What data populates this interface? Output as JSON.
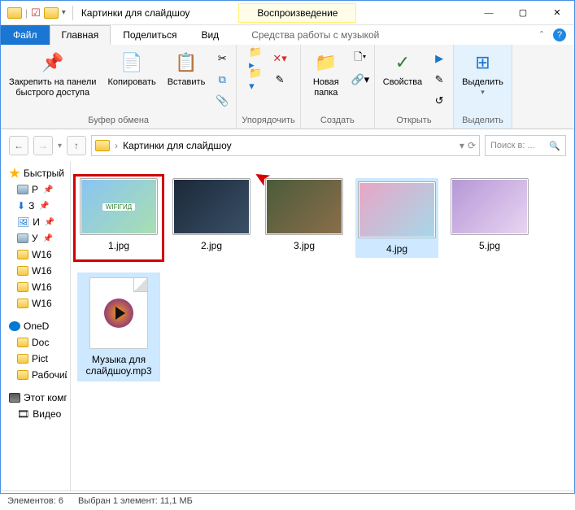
{
  "title": "Картинки для слайдшоу",
  "contextual_tab": "Воспроизведение",
  "tabs": {
    "file": "Файл",
    "home": "Главная",
    "share": "Поделиться",
    "view": "Вид",
    "music": "Средства работы с музыкой"
  },
  "ribbon": {
    "clipboard": {
      "label": "Буфер обмена",
      "pin": "Закрепить на панели\nбыстрого доступа",
      "copy": "Копировать",
      "paste": "Вставить"
    },
    "organize": {
      "label": "Упорядочить"
    },
    "new": {
      "label": "Создать",
      "folder": "Новая\nпапка"
    },
    "open": {
      "label": "Открыть",
      "props": "Свойства"
    },
    "select": {
      "label": "Выделить",
      "all": "Выделить"
    }
  },
  "nav": {
    "breadcrumb": [
      "Картинки для слайдшоу"
    ],
    "search_placeholder": "Поиск в: ..."
  },
  "tree": {
    "quick": "Быстрый доступ",
    "items": [
      "Р",
      "З",
      "И",
      "У"
    ],
    "wifi": [
      "W16",
      "W16",
      "W16",
      "W16"
    ],
    "onedrive": "OneD",
    "docs": "Doc",
    "pict": "Pict",
    "work": "Рабочий стол",
    "thispc": "Этот компьютер",
    "video": "Видео"
  },
  "files": [
    {
      "name": "1.jpg",
      "kind": "img",
      "highlighted": true,
      "cls": ""
    },
    {
      "name": "2.jpg",
      "kind": "img",
      "cls": "dark"
    },
    {
      "name": "3.jpg",
      "kind": "img",
      "cls": "room"
    },
    {
      "name": "4.jpg",
      "kind": "img",
      "cls": "pink",
      "selected": true
    },
    {
      "name": "5.jpg",
      "kind": "img",
      "cls": "violet"
    },
    {
      "name": "Музыка для слайдшоу.mp3",
      "kind": "mp3",
      "selected": true
    }
  ],
  "status": {
    "count": "Элементов: 6",
    "selection": "Выбран 1 элемент: 11,1 МБ"
  }
}
